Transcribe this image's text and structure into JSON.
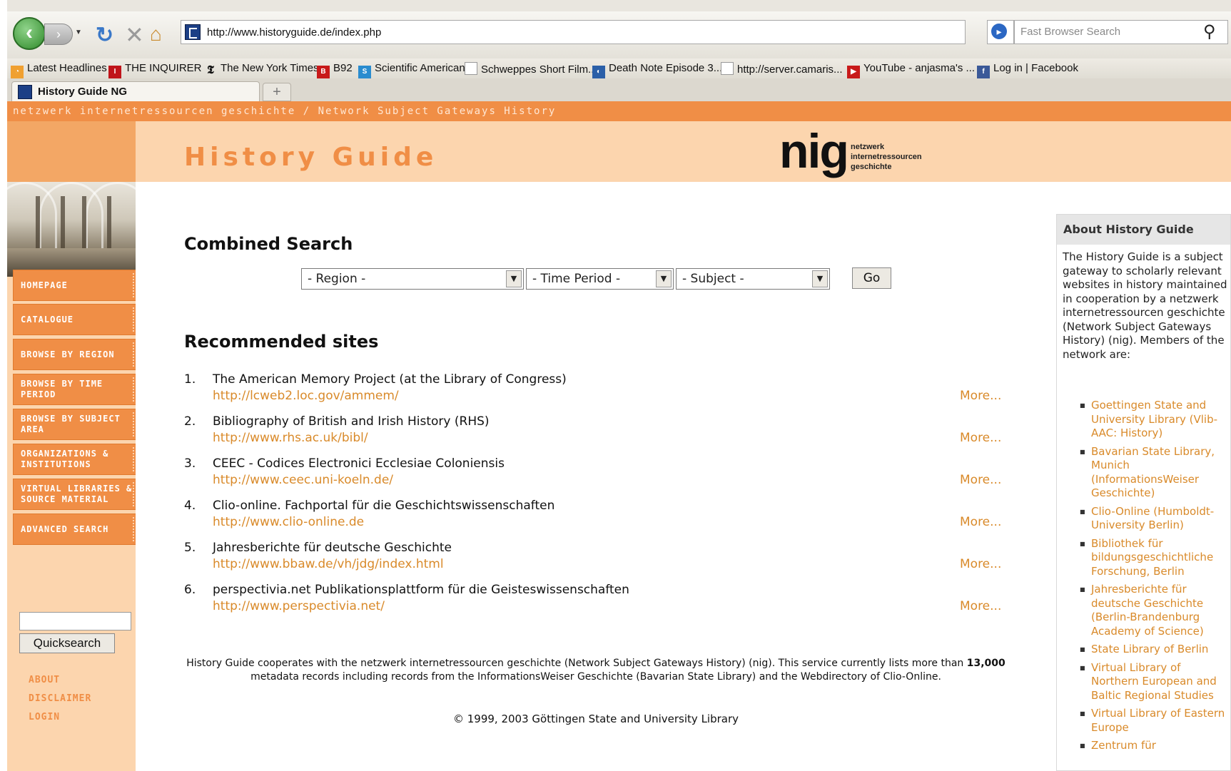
{
  "browser": {
    "url": "http://www.historyguide.de/index.php",
    "search_placeholder": "Fast Browser Search",
    "tab_title": "History Guide NG",
    "new_tab": "+",
    "bookmarks": [
      "Latest Headlines",
      "THE INQUIRER",
      "The New York Times",
      "B92",
      "Scientific American",
      "Schweppes Short Film...",
      "Death Note Episode 3...",
      "http://server.camaris...",
      "YouTube - anjasma's ...",
      "Log in | Facebook"
    ]
  },
  "header": {
    "strip": "netzwerk internetressourcen geschichte / Network Subject Gateways History",
    "title": "History Guide",
    "logo": "nig",
    "logo_sub": [
      "netzwerk",
      "internetressourcen",
      "geschichte"
    ]
  },
  "nav": {
    "buttons": [
      "HOMEPAGE",
      "CATALOGUE",
      "BROWSE BY REGION",
      "BROWSE BY TIME PERIOD",
      "BROWSE BY SUBJECT AREA",
      "ORGANIZATIONS & INSTITUTIONS",
      "VIRTUAL LIBRARIES & SOURCE MATERIAL",
      "ADVANCED SEARCH"
    ],
    "quicksearch_label": "Quicksearch",
    "links": [
      "ABOUT",
      "DISCLAIMER",
      "LOGIN"
    ]
  },
  "search": {
    "heading": "Combined Search",
    "region": "- Region -",
    "time_period": "- Time Period -",
    "subject": "- Subject -",
    "go": "Go"
  },
  "recommended": {
    "heading": "Recommended sites",
    "more_label": "More...",
    "items": [
      {
        "num": "1.",
        "title": "The American Memory Project (at the Library of Congress)",
        "url": "http://lcweb2.loc.gov/ammem/"
      },
      {
        "num": "2.",
        "title": "Bibliography of British and Irish History (RHS)",
        "url": "http://www.rhs.ac.uk/bibl/"
      },
      {
        "num": "3.",
        "title": "CEEC - Codices Electronici Ecclesiae Coloniensis",
        "url": "http://www.ceec.uni-koeln.de/"
      },
      {
        "num": "4.",
        "title": "Clio-online. Fachportal für die Geschichtswissenschaften",
        "url": "http://www.clio-online.de"
      },
      {
        "num": "5.",
        "title": "Jahresberichte für deutsche Geschichte",
        "url": "http://www.bbaw.de/vh/jdg/index.html"
      },
      {
        "num": "6.",
        "title": "perspectivia.net Publikationsplattform für die Geisteswissenschaften",
        "url": "http://www.perspectivia.net/"
      }
    ]
  },
  "footer": {
    "text_before": "History Guide cooperates with the netzwerk internetressourcen geschichte (Network Subject Gateways History) (nig). This service currently lists more than ",
    "count": "13,000",
    "text_after": " metadata records including records from the InformationsWeiser Geschichte (Bavarian State Library) and the Webdirectory of Clio-Online.",
    "copyright": "© 1999, 2003 Göttingen State and University Library"
  },
  "about": {
    "heading": "About History Guide",
    "text": "The History Guide is a subject gateway to scholarly relevant websites in history maintained in cooperation by a netzwerk internetressourcen geschichte (Network Subject Gateways History) (nig). Members of the network are:",
    "members": [
      "Goettingen State and University Library (Vlib-AAC: History)",
      "Bavarian State Library, Munich (InformationsWeiser Geschichte)",
      "Clio-Online (Humboldt-University Berlin)",
      "Bibliothek für bildungsgeschichtliche Forschung, Berlin",
      "Jahresberichte für deutsche Geschichte (Berlin-Brandenburg Academy of Science)",
      "State Library of Berlin",
      "Virtual Library of Northern European and Baltic Regional Studies",
      "Virtual Library of Eastern Europe",
      "Zentrum für"
    ]
  },
  "colors": {
    "accent": "#f08e46",
    "light": "#fcd5ae",
    "link": "#d98a2a"
  }
}
